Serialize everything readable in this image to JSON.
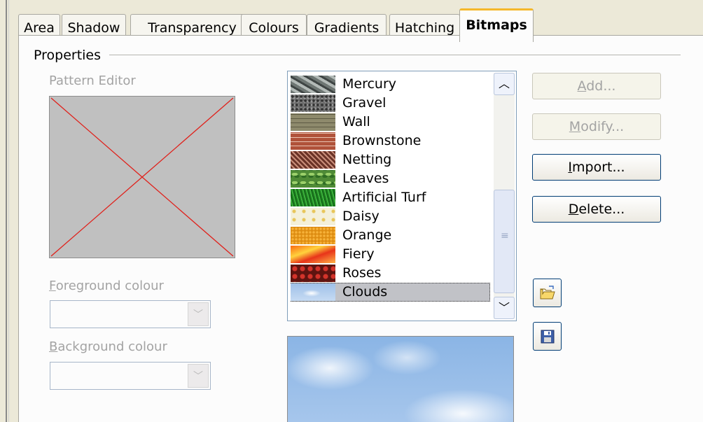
{
  "tabs": [
    {
      "label": "Area"
    },
    {
      "label": "Shadow"
    },
    {
      "label": "Transparency"
    },
    {
      "label": "Colours"
    },
    {
      "label": "Gradients"
    },
    {
      "label": "Hatching"
    },
    {
      "label": "Bitmaps"
    }
  ],
  "active_tab": "Bitmaps",
  "properties": {
    "title": "Properties",
    "pattern_editor_label": "Pattern Editor",
    "foreground": {
      "first": "F",
      "rest": "oreground colour",
      "value": ""
    },
    "background": {
      "first": "B",
      "rest": "ackground colour",
      "value": ""
    }
  },
  "bitmap_list": {
    "items": [
      {
        "name": "Mercury",
        "thumb": "mercury"
      },
      {
        "name": "Gravel",
        "thumb": "gravel"
      },
      {
        "name": "Wall",
        "thumb": "wall"
      },
      {
        "name": "Brownstone",
        "thumb": "brownstone"
      },
      {
        "name": "Netting",
        "thumb": "netting"
      },
      {
        "name": "Leaves",
        "thumb": "leaves"
      },
      {
        "name": "Artificial Turf",
        "thumb": "turf"
      },
      {
        "name": "Daisy",
        "thumb": "daisy"
      },
      {
        "name": "Orange",
        "thumb": "orange"
      },
      {
        "name": "Fiery",
        "thumb": "fiery"
      },
      {
        "name": "Roses",
        "thumb": "roses"
      },
      {
        "name": "Clouds",
        "thumb": "clouds"
      }
    ],
    "selected": "Clouds"
  },
  "buttons": {
    "add": {
      "first": "A",
      "rest": "dd...",
      "enabled": false
    },
    "modify": {
      "first": "M",
      "rest": "odify...",
      "enabled": false
    },
    "import": {
      "first": "I",
      "rest": "mport...",
      "enabled": true
    },
    "delete": {
      "first": "D",
      "rest": "elete...",
      "enabled": true
    }
  },
  "icons": {
    "load": "open-folder-icon",
    "save": "floppy-disk-icon"
  },
  "colors": {
    "active_tab_accent": "#f5b82a",
    "pattern_cross": "#e0201a",
    "selection": "#c1c2c7"
  }
}
